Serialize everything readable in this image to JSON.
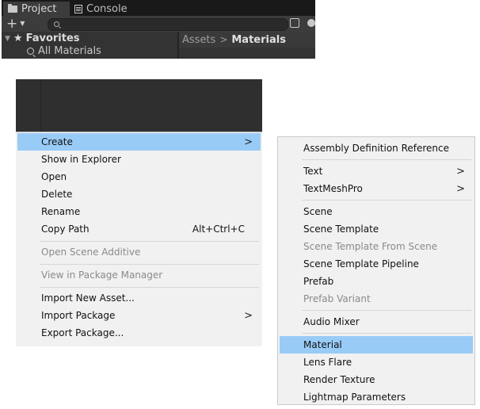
{
  "editor": {
    "tabs": [
      {
        "label": "Project"
      },
      {
        "label": "Console"
      }
    ],
    "favorites_label": "Favorites",
    "all_materials_label": "All Materials",
    "breadcrumb": {
      "root": "Assets",
      "separator": ">",
      "current": "Materials"
    }
  },
  "context_menu": {
    "items": [
      {
        "label": "Create",
        "arrow": ">"
      },
      {
        "label": "Show in Explorer"
      },
      {
        "label": "Open"
      },
      {
        "label": "Delete"
      },
      {
        "label": "Rename"
      },
      {
        "label": "Copy Path",
        "shortcut": "Alt+Ctrl+C"
      },
      {
        "label": "Open Scene Additive"
      },
      {
        "label": "View in Package Manager"
      },
      {
        "label": "Import New Asset..."
      },
      {
        "label": "Import Package",
        "arrow": ">"
      },
      {
        "label": "Export Package..."
      }
    ]
  },
  "create_submenu": {
    "items": [
      {
        "label": "Assembly Definition Reference"
      },
      {
        "label": "Text",
        "arrow": ">"
      },
      {
        "label": "TextMeshPro",
        "arrow": ">"
      },
      {
        "label": "Scene"
      },
      {
        "label": "Scene Template"
      },
      {
        "label": "Scene Template From Scene"
      },
      {
        "label": "Scene Template Pipeline"
      },
      {
        "label": "Prefab"
      },
      {
        "label": "Prefab Variant"
      },
      {
        "label": "Audio Mixer"
      },
      {
        "label": "Material"
      },
      {
        "label": "Lens Flare"
      },
      {
        "label": "Render Texture"
      },
      {
        "label": "Lightmap Parameters"
      }
    ]
  }
}
